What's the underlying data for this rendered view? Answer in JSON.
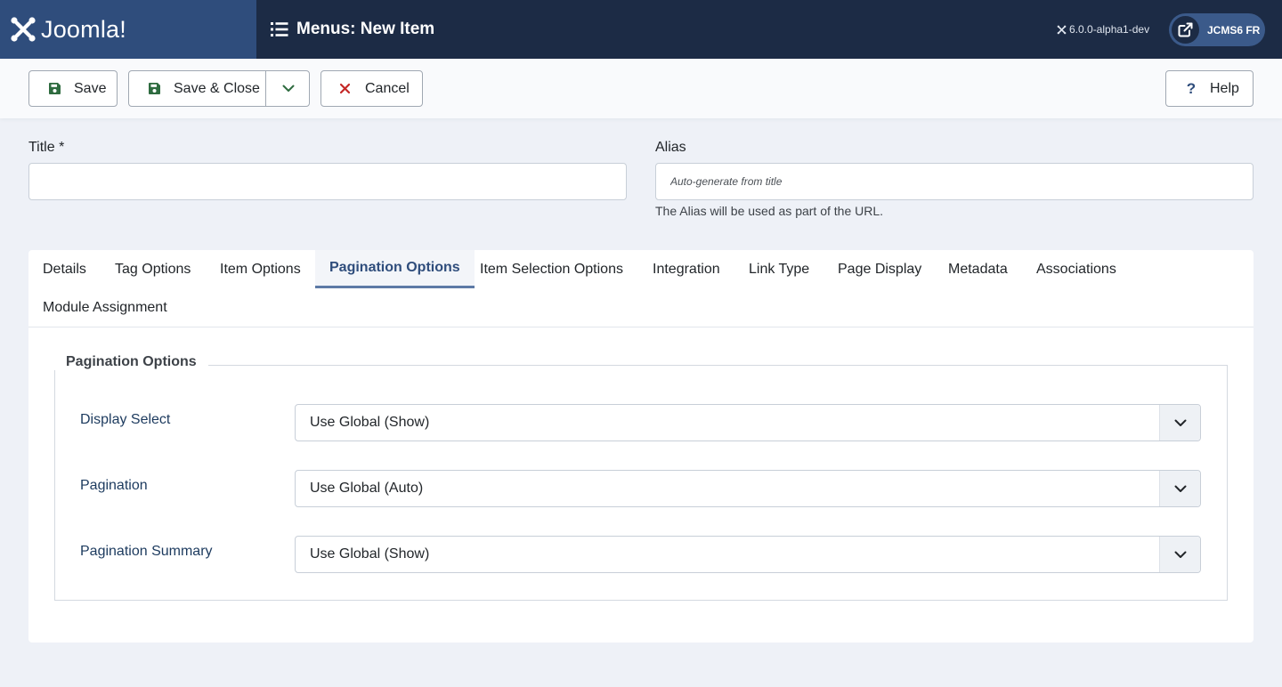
{
  "header": {
    "logo_text": "Joomla!",
    "page_title": "Menus: New Item",
    "version": "6.0.0-alpha1-dev",
    "user_label": "JCMS6 FR",
    "colors": {
      "header_bg": "#1c2b45",
      "logo_bg": "#2f4d7c",
      "user_btn_bg": "#3b5a8a"
    }
  },
  "toolbar": {
    "save_label": "Save",
    "save_close_label": "Save & Close",
    "cancel_label": "Cancel",
    "help_label": "Help",
    "colors": {
      "save_icon": "#2e6b3f",
      "cancel_icon": "#c52827",
      "help_icon": "#2f4d7c"
    }
  },
  "form": {
    "title_label": "Title *",
    "title_value": "",
    "alias_label": "Alias",
    "alias_placeholder": "Auto-generate from title",
    "alias_help": "The Alias will be used as part of the URL."
  },
  "tabs": [
    {
      "label": "Details",
      "active": false
    },
    {
      "label": "Tag Options",
      "active": false
    },
    {
      "label": "Item Options",
      "active": false
    },
    {
      "label": "Pagination Options",
      "active": true
    },
    {
      "label": "Item Selection Options",
      "active": false
    },
    {
      "label": "Integration",
      "active": false
    },
    {
      "label": "Link Type",
      "active": false
    },
    {
      "label": "Page Display",
      "active": false
    },
    {
      "label": "Metadata",
      "active": false
    },
    {
      "label": "Associations",
      "active": false
    },
    {
      "label": "Module Assignment",
      "active": false
    }
  ],
  "pagination_options": {
    "legend": "Pagination Options",
    "fields": [
      {
        "label": "Display Select",
        "value": "Use Global (Show)"
      },
      {
        "label": "Pagination",
        "value": "Use Global (Auto)"
      },
      {
        "label": "Pagination Summary",
        "value": "Use Global (Show)"
      }
    ]
  }
}
